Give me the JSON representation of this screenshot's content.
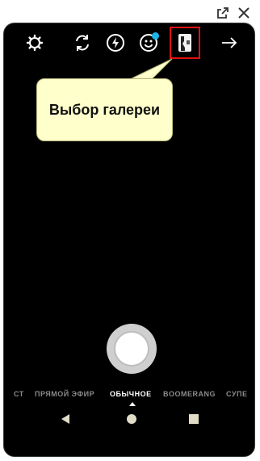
{
  "callout": {
    "text": "Выбор галереи"
  },
  "modes": [
    {
      "label": "СТ"
    },
    {
      "label": "ПРЯМОЙ ЭФИР"
    },
    {
      "label": "ОБЫЧНОЕ",
      "active": true
    },
    {
      "label": "BOOMERANG"
    },
    {
      "label": "СУПЕ"
    }
  ],
  "icons": {
    "external": "external-link-icon",
    "close": "close-icon",
    "settings": "settings-icon",
    "flip": "flip-camera-icon",
    "flash": "flash-icon",
    "face": "face-filter-icon",
    "gallery": "gallery-icon",
    "next": "arrow-right-icon",
    "back": "back-icon",
    "home": "home-icon",
    "recent": "recent-apps-icon"
  },
  "colors": {
    "highlight": "#e01010",
    "notification_dot": "#1fb4e8",
    "callout_bg": "#ffffcc"
  }
}
